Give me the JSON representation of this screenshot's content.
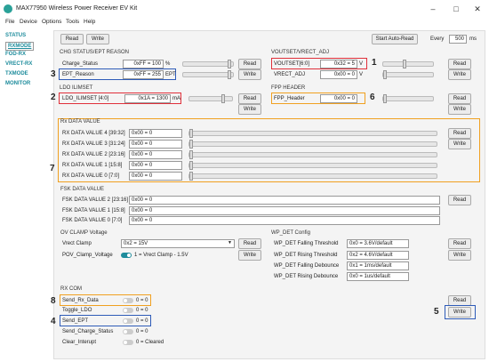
{
  "window": {
    "title": "MAX77950 Wireless Power Receiver EV Kit"
  },
  "menu": [
    "File",
    "Device",
    "Options",
    "Tools",
    "Help"
  ],
  "sidebar": [
    "STATUS",
    "RXMODE",
    "FOD-RX",
    "VRECT-RX",
    "TXMODE",
    "MONITOR"
  ],
  "toolbar": {
    "read": "Read",
    "write": "Write",
    "auto_read": "Start Auto-Read",
    "every": "Every",
    "interval": "500",
    "unit": "ms"
  },
  "chg": {
    "title": "CHG STATUS/EPT REASON",
    "rows": [
      {
        "label": "Charge_Status",
        "value": "0xFF = 100",
        "unit": "%"
      },
      {
        "label": "EPT_Reason",
        "value": "0xFF = 255",
        "unit": "EPT"
      }
    ],
    "read": "Read",
    "write": "Write"
  },
  "vout": {
    "title": "VOUTSET/VRECT_ADJ",
    "rows": [
      {
        "label": "VOUTSET[6:0]",
        "value": "0x32 = 5",
        "unit": "V"
      },
      {
        "label": "VRECT_ADJ",
        "value": "0x00 = 0",
        "unit": "V"
      }
    ],
    "read": "Read",
    "write": "Write"
  },
  "ldo": {
    "title": "LDO ILIMSET",
    "label": "LDO_ILIMSET [4:0]",
    "value": "0x1A = 1300",
    "unit": "mA",
    "read": "Read",
    "write": "Write"
  },
  "fpp": {
    "title": "FPP HEADER",
    "label": "FPP_Header",
    "value": "0x00 = 0",
    "read": "Read",
    "write": "Write"
  },
  "rxdata": {
    "title": "Rx DATA VALUE",
    "rows": [
      {
        "label": "RX DATA VALUE 4 [39:32]",
        "value": "0x00 = 0"
      },
      {
        "label": "RX DATA VALUE 3 [31:24]",
        "value": "0x00 = 0"
      },
      {
        "label": "RX DATA VALUE 2 [23:16]",
        "value": "0x00 = 0"
      },
      {
        "label": "RX DATA VALUE 1 [15:8]",
        "value": "0x00 = 0"
      },
      {
        "label": "RX DATA VALUE 0 [7:0]",
        "value": "0x00 = 0"
      }
    ],
    "read": "Read",
    "write": "Write"
  },
  "fsk": {
    "title": "FSK DATA VALUE",
    "rows": [
      {
        "label": "FSK DATA VALUE 2 [23:16]",
        "value": "0x00 = 0"
      },
      {
        "label": "FSK DATA VALUE 1 [15:8]",
        "value": "0x00 = 0"
      },
      {
        "label": "FSK DATA VALUE 0 [7:0]",
        "value": "0x00 = 0"
      }
    ],
    "read": "Read"
  },
  "ov": {
    "title": "OV CLAMP Voltage",
    "vrect_label": "Vrect Clamp",
    "vrect_value": "0x2 = 15V",
    "pov_label": "POV_Clamp_Voltage",
    "pov_value": "1 = Vrect Clamp - 1.5V",
    "read": "Read",
    "write": "Write"
  },
  "wpdet": {
    "title": "WP_DET Config",
    "rows": [
      {
        "label": "WP_DET Falling Threshold",
        "value": "0x0 = 3.6V/default"
      },
      {
        "label": "WP_DET Rising Threshold",
        "value": "0x2 = 4.6V/default"
      },
      {
        "label": "WP_DET Falling Debounce",
        "value": "0x1 = 1ms/default"
      },
      {
        "label": "WP_DET Rising Debounce",
        "value": "0x0 = 1us/default"
      }
    ],
    "read": "Read",
    "write": "Write"
  },
  "rxcom": {
    "title": "RX COM",
    "rows": [
      {
        "label": "Send_Rx_Data",
        "value": "0 = 0"
      },
      {
        "label": "Toggle_LDO",
        "value": "0 = 0"
      },
      {
        "label": "Send_EPT",
        "value": "0 = 0"
      },
      {
        "label": "Send_Charge_Status",
        "value": "0 = 0"
      },
      {
        "label": "Clear_Interupt",
        "value": "0 = Cleared"
      }
    ],
    "read": "Read",
    "write": "Write"
  },
  "callouts": [
    "1",
    "2",
    "3",
    "4",
    "5",
    "6",
    "7",
    "8"
  ],
  "colors": {
    "red": "#e0303a",
    "blue": "#2e5bb8",
    "orange": "#f0a020",
    "accent": "#1e8c9c"
  }
}
